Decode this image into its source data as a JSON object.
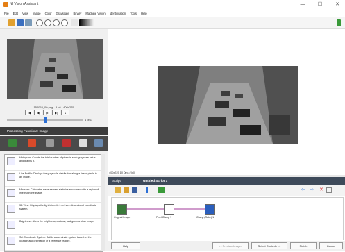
{
  "window": {
    "title": "NI Vision Assistant",
    "minimize": "—",
    "maximize": "☐",
    "close": "✕"
  },
  "menubar": {
    "items": [
      "File",
      "Edit",
      "View",
      "Image",
      "Color",
      "Grayscale",
      "Binary",
      "Machine Vision",
      "Identification",
      "Tools",
      "Help"
    ]
  },
  "browser": {
    "caption": "154053_00.png - 8-bit - 400x225",
    "nav_buttons": [
      "|◀",
      "◀",
      "▶",
      "▶|",
      "↳"
    ],
    "page_indicator": "1 of 1",
    "slider_fraction": 0.5
  },
  "processing": {
    "header": "Processing Functions: Image",
    "functions": [
      {
        "name": "Histogram",
        "text": "Histogram: Counts the total number of pixels in each grayscale value and graphs it."
      },
      {
        "name": "Line Profile",
        "text": "Line Profile: Displays the grayscale distribution along a line of pixels in an image."
      },
      {
        "name": "Measure",
        "text": "Measure: Calculates measurement statistics associated with a region of interest in the image."
      },
      {
        "name": "3D View",
        "text": "3D View: Displays the light intensity in a three-dimensional coordinate system."
      },
      {
        "name": "Brightness",
        "text": "Brightness: Alters the brightness, contrast, and gamma of an image."
      },
      {
        "name": "Set Coordinate System",
        "text": "Set Coordinate System: Builds a coordinate system based on the location and orientation of a reference feature."
      }
    ]
  },
  "image_status": "400x225 1X 0ms   (0x0)",
  "script": {
    "header_left": "Script:",
    "header_title": "Untitled Script 1",
    "steps": [
      {
        "label": "Original Image",
        "color": "#3a7a3a"
      },
      {
        "label": "Pixel Clamp 1",
        "color": "#ffffff"
      },
      {
        "label": "Clamp (Rake) 1",
        "color": "#2b5fbd"
      }
    ]
  },
  "buttons": {
    "help": "Help",
    "preview_images": "<< Preview Images",
    "select_controls": "Select Controls >>",
    "finish": "Finish",
    "cancel": "Cancel"
  },
  "colors": {
    "accent": "#2b6fd6",
    "dark_header": "#3c3c3c",
    "script_header": "#3e4a5a"
  }
}
